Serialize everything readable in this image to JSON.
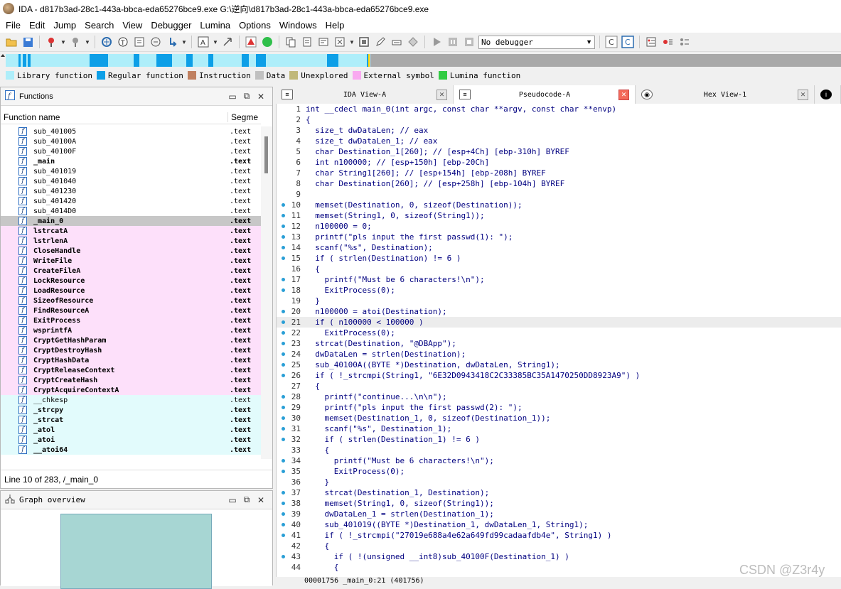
{
  "window": {
    "title": "IDA - d817b3ad-28c1-443a-bbca-eda65276bce9.exe G:\\逆向\\d817b3ad-28c1-443a-bbca-eda65276bce9.exe"
  },
  "menu": [
    "File",
    "Edit",
    "Jump",
    "Search",
    "View",
    "Debugger",
    "Lumina",
    "Options",
    "Windows",
    "Help"
  ],
  "toolbar": {
    "debugger_value": "No debugger"
  },
  "legend": [
    {
      "label": "Library function",
      "color": "#aeeefa"
    },
    {
      "label": "Regular function",
      "color": "#0d9fe7"
    },
    {
      "label": "Instruction",
      "color": "#c08060"
    },
    {
      "label": "Data",
      "color": "#c0c0c0"
    },
    {
      "label": "Unexplored",
      "color": "#c0b87a"
    },
    {
      "label": "External symbol",
      "color": "#f9a9f0"
    },
    {
      "label": "Lumina function",
      "color": "#33cc44"
    }
  ],
  "functions_panel": {
    "title": "Functions",
    "col_name": "Function name",
    "col_segment": "Segme",
    "status": "Line 10 of 283, /_main_0",
    "rows": [
      {
        "name": "sub_401005",
        "seg": ".text",
        "style": ""
      },
      {
        "name": "sub_40100A",
        "seg": ".text",
        "style": ""
      },
      {
        "name": "sub_40100F",
        "seg": ".text",
        "style": ""
      },
      {
        "name": "_main",
        "seg": ".text",
        "style": "bold"
      },
      {
        "name": "sub_401019",
        "seg": ".text",
        "style": ""
      },
      {
        "name": "sub_401040",
        "seg": ".text",
        "style": ""
      },
      {
        "name": "sub_401230",
        "seg": ".text",
        "style": ""
      },
      {
        "name": "sub_401420",
        "seg": ".text",
        "style": ""
      },
      {
        "name": "sub_4014D0",
        "seg": ".text",
        "style": ""
      },
      {
        "name": "_main_0",
        "seg": ".text",
        "style": "bold selected"
      },
      {
        "name": "lstrcatA",
        "seg": ".text",
        "style": "bold pink"
      },
      {
        "name": "lstrlenA",
        "seg": ".text",
        "style": "bold pink"
      },
      {
        "name": "CloseHandle",
        "seg": ".text",
        "style": "bold pink"
      },
      {
        "name": "WriteFile",
        "seg": ".text",
        "style": "bold pink"
      },
      {
        "name": "CreateFileA",
        "seg": ".text",
        "style": "bold pink"
      },
      {
        "name": "LockResource",
        "seg": ".text",
        "style": "bold pink"
      },
      {
        "name": "LoadResource",
        "seg": ".text",
        "style": "bold pink"
      },
      {
        "name": "SizeofResource",
        "seg": ".text",
        "style": "bold pink"
      },
      {
        "name": "FindResourceA",
        "seg": ".text",
        "style": "bold pink"
      },
      {
        "name": "ExitProcess",
        "seg": ".text",
        "style": "bold pink"
      },
      {
        "name": "wsprintfA",
        "seg": ".text",
        "style": "bold pink"
      },
      {
        "name": "CryptGetHashParam",
        "seg": ".text",
        "style": "bold pink"
      },
      {
        "name": "CryptDestroyHash",
        "seg": ".text",
        "style": "bold pink"
      },
      {
        "name": "CryptHashData",
        "seg": ".text",
        "style": "bold pink"
      },
      {
        "name": "CryptReleaseContext",
        "seg": ".text",
        "style": "bold pink"
      },
      {
        "name": "CryptCreateHash",
        "seg": ".text",
        "style": "bold pink"
      },
      {
        "name": "CryptAcquireContextA",
        "seg": ".text",
        "style": "bold pink"
      },
      {
        "name": "__chkesp",
        "seg": ".text",
        "style": "cyan"
      },
      {
        "name": "_strcpy",
        "seg": ".text",
        "style": "bold cyan"
      },
      {
        "name": "_strcat",
        "seg": ".text",
        "style": "bold cyan"
      },
      {
        "name": "_atol",
        "seg": ".text",
        "style": "bold cyan"
      },
      {
        "name": "_atoi",
        "seg": ".text",
        "style": "bold cyan"
      },
      {
        "name": "__atoi64",
        "seg": ".text",
        "style": "bold cyan"
      }
    ]
  },
  "graph_panel": {
    "title": "Graph overview"
  },
  "tabs": [
    {
      "label": "IDA View-A",
      "active": false,
      "icon": "ida-view-icon"
    },
    {
      "label": "Pseudocode-A",
      "active": true,
      "icon": "pseudocode-icon"
    },
    {
      "label": "Hex View-1",
      "active": false,
      "icon": "hex-view-icon"
    }
  ],
  "code": [
    {
      "n": "1",
      "dot": false,
      "t": "int __cdecl main_0(int argc, const char **argv, const char **envp)"
    },
    {
      "n": "2",
      "dot": false,
      "t": "{"
    },
    {
      "n": "3",
      "dot": false,
      "t": "  size_t dwDataLen; // eax"
    },
    {
      "n": "4",
      "dot": false,
      "t": "  size_t dwDataLen_1; // eax"
    },
    {
      "n": "5",
      "dot": false,
      "t": "  char Destination_1[260]; // [esp+4Ch] [ebp-310h] BYREF"
    },
    {
      "n": "6",
      "dot": false,
      "t": "  int n100000; // [esp+150h] [ebp-20Ch]"
    },
    {
      "n": "7",
      "dot": false,
      "t": "  char String1[260]; // [esp+154h] [ebp-208h] BYREF"
    },
    {
      "n": "8",
      "dot": false,
      "t": "  char Destination[260]; // [esp+258h] [ebp-104h] BYREF"
    },
    {
      "n": "9",
      "dot": false,
      "t": ""
    },
    {
      "n": "10",
      "dot": true,
      "t": "  memset(Destination, 0, sizeof(Destination));"
    },
    {
      "n": "11",
      "dot": true,
      "t": "  memset(String1, 0, sizeof(String1));"
    },
    {
      "n": "12",
      "dot": true,
      "t": "  n100000 = 0;"
    },
    {
      "n": "13",
      "dot": true,
      "t": "  printf(\"pls input the first passwd(1): \");"
    },
    {
      "n": "14",
      "dot": true,
      "t": "  scanf(\"%s\", Destination);"
    },
    {
      "n": "15",
      "dot": true,
      "t": "  if ( strlen(Destination) != 6 )"
    },
    {
      "n": "16",
      "dot": false,
      "t": "  {"
    },
    {
      "n": "17",
      "dot": true,
      "t": "    printf(\"Must be 6 characters!\\n\");"
    },
    {
      "n": "18",
      "dot": true,
      "t": "    ExitProcess(0);"
    },
    {
      "n": "19",
      "dot": false,
      "t": "  }"
    },
    {
      "n": "20",
      "dot": true,
      "t": "  n100000 = atoi(Destination);"
    },
    {
      "n": "21",
      "dot": true,
      "t": "  if ( n100000 < 100000 )"
    },
    {
      "n": "22",
      "dot": true,
      "t": "    ExitProcess(0);"
    },
    {
      "n": "23",
      "dot": true,
      "t": "  strcat(Destination, \"@DBApp\");"
    },
    {
      "n": "24",
      "dot": true,
      "t": "  dwDataLen = strlen(Destination);"
    },
    {
      "n": "25",
      "dot": true,
      "t": "  sub_40100A((BYTE *)Destination, dwDataLen, String1);"
    },
    {
      "n": "26",
      "dot": true,
      "t": "  if ( !_strcmpi(String1, \"6E32D0943418C2C33385BC35A1470250DD8923A9\") )"
    },
    {
      "n": "27",
      "dot": false,
      "t": "  {"
    },
    {
      "n": "28",
      "dot": true,
      "t": "    printf(\"continue...\\n\\n\");"
    },
    {
      "n": "29",
      "dot": true,
      "t": "    printf(\"pls input the first passwd(2): \");"
    },
    {
      "n": "30",
      "dot": true,
      "t": "    memset(Destination_1, 0, sizeof(Destination_1));"
    },
    {
      "n": "31",
      "dot": true,
      "t": "    scanf(\"%s\", Destination_1);"
    },
    {
      "n": "32",
      "dot": true,
      "t": "    if ( strlen(Destination_1) != 6 )"
    },
    {
      "n": "33",
      "dot": false,
      "t": "    {"
    },
    {
      "n": "34",
      "dot": true,
      "t": "      printf(\"Must be 6 characters!\\n\");"
    },
    {
      "n": "35",
      "dot": true,
      "t": "      ExitProcess(0);"
    },
    {
      "n": "36",
      "dot": false,
      "t": "    }"
    },
    {
      "n": "37",
      "dot": true,
      "t": "    strcat(Destination_1, Destination);"
    },
    {
      "n": "38",
      "dot": true,
      "t": "    memset(String1, 0, sizeof(String1));"
    },
    {
      "n": "39",
      "dot": true,
      "t": "    dwDataLen_1 = strlen(Destination_1);"
    },
    {
      "n": "40",
      "dot": true,
      "t": "    sub_401019((BYTE *)Destination_1, dwDataLen_1, String1);"
    },
    {
      "n": "41",
      "dot": true,
      "t": "    if ( !_strcmpi(\"27019e688a4e62a649fd99cadaafdb4e\", String1) )"
    },
    {
      "n": "42",
      "dot": false,
      "t": "    {"
    },
    {
      "n": "43",
      "dot": true,
      "t": "      if ( !(unsigned __int8)sub_40100F(Destination_1) )"
    },
    {
      "n": "44",
      "dot": false,
      "t": "      {"
    }
  ],
  "highlight_line": "21",
  "status_line": "00001756 _main_0:21 (401756)",
  "watermark": "CSDN @Z3r4y"
}
